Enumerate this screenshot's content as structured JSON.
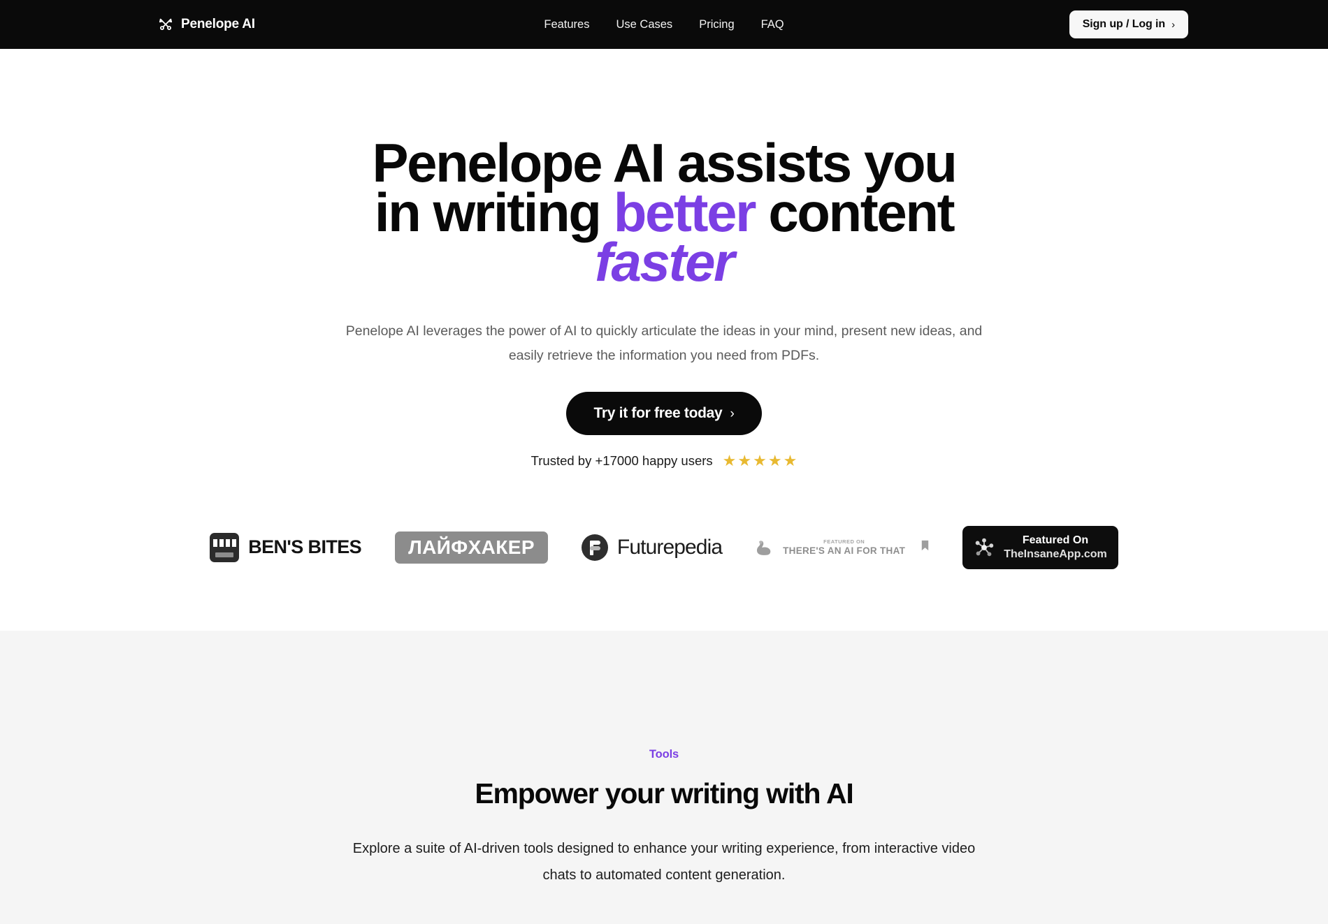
{
  "navbar": {
    "brand": {
      "icon": "crossed-pens-icon",
      "name": "Penelope AI"
    },
    "links": [
      {
        "label": "Features"
      },
      {
        "label": "Use Cases"
      },
      {
        "label": "Pricing"
      },
      {
        "label": "FAQ"
      }
    ],
    "cta": {
      "label": "Sign up / Log in",
      "chevron": "›"
    },
    "background": "#0a0a0a"
  },
  "hero": {
    "title": {
      "line1": "Penelope AI assists you",
      "line2_part1": "in writing ",
      "line2_accent": "better",
      "line2_part2": " content",
      "line3_accent": "faster"
    },
    "subtitle": "Penelope AI leverages the power of AI to quickly articulate the ideas in your mind, present new ideas, and easily retrieve the information you need from PDFs.",
    "cta": {
      "label": "Try it for free today",
      "chevron": "›"
    },
    "trusted": {
      "text": "Trusted by +17000 happy users",
      "stars": [
        "★",
        "★",
        "★",
        "★",
        "★"
      ],
      "star_color": "#e8b931"
    },
    "accent_color": "#7b3fe4"
  },
  "logobar": {
    "items": [
      {
        "name": "bens-bites",
        "text": "BEN'S BITES"
      },
      {
        "name": "layfhaker",
        "text": "ЛАЙФХАКЕР"
      },
      {
        "name": "futurepedia",
        "text": "Futurepedia"
      },
      {
        "name": "theres-an-ai-for-that",
        "small": "FEATURED ON",
        "big": "THERE'S AN AI FOR THAT"
      },
      {
        "name": "theinsaneapp",
        "line1": "Featured On",
        "line2": "TheInsaneApp.com"
      }
    ]
  },
  "tools": {
    "eyebrow": "Tools",
    "title": "Empower your writing with AI",
    "subtitle": "Explore a suite of AI-driven tools designed to enhance your writing experience, from interactive video chats to automated content generation.",
    "background": "#f5f5f5",
    "eyebrow_color": "#7b3fe4"
  }
}
